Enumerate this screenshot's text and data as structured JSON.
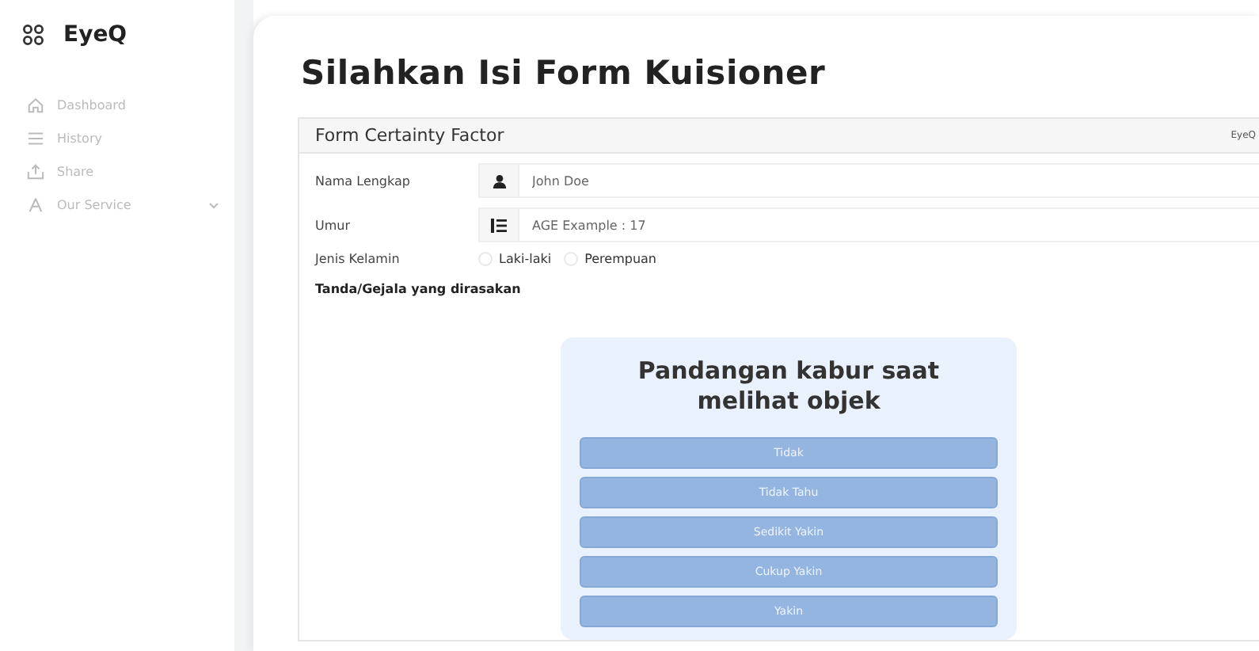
{
  "sidebar": {
    "brand": "EyeQ",
    "items": [
      {
        "label": "Dashboard",
        "expandable": false
      },
      {
        "label": "History",
        "expandable": false
      },
      {
        "label": "Share",
        "expandable": false
      },
      {
        "label": "Our Service",
        "expandable": true
      }
    ]
  },
  "page_title": "Silahkan Isi Form Kuisioner",
  "form": {
    "title": "Form Certainty Factor",
    "brand": "EyeQ",
    "fields": [
      {
        "label": "Nama Lengkap",
        "placeholder": "John Doe"
      },
      {
        "label": "Umur",
        "placeholder": "AGE Example : 17"
      }
    ],
    "gender": {
      "label": "Jenis Kelamin",
      "options": [
        {
          "label": "Laki-laki",
          "selected": false
        },
        {
          "label": "Perempuan",
          "selected": false
        }
      ]
    },
    "symptoms_heading": "Tanda/Gejala yang dirasakan",
    "question": {
      "text": "Pandangan kabur saat melihat objek",
      "answers": [
        "Tidak",
        "Tidak Tahu",
        "Sedikit Yakin",
        "Cukup Yakin",
        "Yakin"
      ]
    }
  }
}
